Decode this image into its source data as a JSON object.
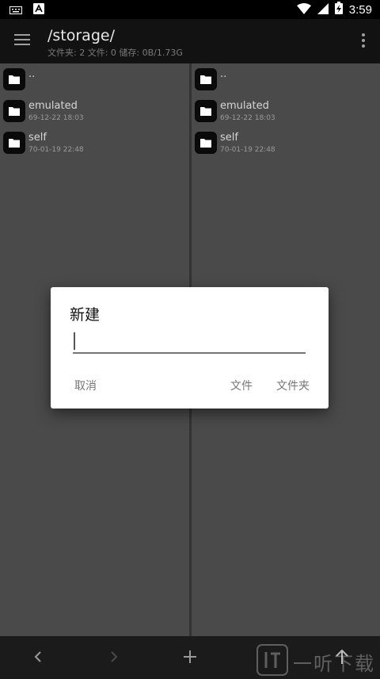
{
  "status_bar": {
    "time": "3:59",
    "icons": [
      "keyboard-icon",
      "notification-a-icon",
      "wifi-icon",
      "signal-icon",
      "battery-charging-icon"
    ]
  },
  "app_bar": {
    "title": "/storage/",
    "subtitle": "文件夹: 2  文件: 0  储存: 0B/1.73G"
  },
  "left_pane": {
    "items": [
      {
        "name": "..",
        "date": ""
      },
      {
        "name": "emulated",
        "date": "69-12-22 18:03"
      },
      {
        "name": "self",
        "date": "70-01-19 22:48"
      }
    ]
  },
  "right_pane": {
    "items": [
      {
        "name": "..",
        "date": ""
      },
      {
        "name": "emulated",
        "date": "69-12-22 18:03"
      },
      {
        "name": "self",
        "date": "70-01-19 22:48"
      }
    ]
  },
  "dialog": {
    "title": "新建",
    "input_value": "",
    "cancel_label": "取消",
    "file_label": "文件",
    "folder_label": "文件夹"
  },
  "bottom_bar": {
    "icons": [
      "back-icon",
      "forward-icon",
      "add-icon",
      "up-icon"
    ]
  },
  "watermark": {
    "text": "一听下载"
  },
  "colors": {
    "pane_bg": "#4a4a4a",
    "toolbar_bg": "#121212",
    "dialog_bg": "#ffffff",
    "button_text": "#757575"
  }
}
